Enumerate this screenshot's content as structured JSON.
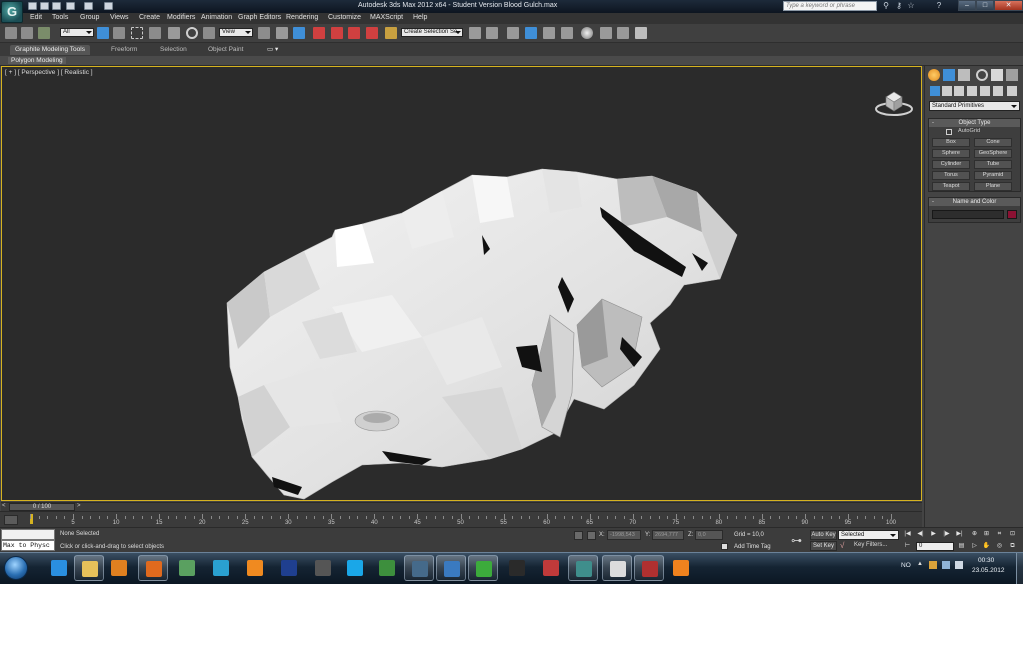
{
  "window": {
    "title": "Autodesk 3ds Max  2012 x64   - Student Version   Blood Gulch.max",
    "logo_letter": "G",
    "help_search_placeholder": "Type a keyword or phrase",
    "min_label": "–",
    "max_label": "□",
    "close_label": "✕"
  },
  "menu": {
    "items": [
      "Edit",
      "Tools",
      "Group",
      "Views",
      "Create",
      "Modifiers",
      "Animation",
      "Graph Editors",
      "Rendering",
      "Customize",
      "MAXScript",
      "Help"
    ]
  },
  "toolbar": {
    "selection_filter": "All",
    "reference_coord": "View",
    "named_selection": "Create Selection Se"
  },
  "ribbon": {
    "tabs": [
      "Graphite Modeling Tools",
      "Freeform",
      "Selection",
      "Object Paint"
    ],
    "active_tab": 0,
    "sub_label": "Polygon Modeling"
  },
  "viewport": {
    "label": "[ + ] [ Perspective ] [ Realistic ]",
    "border_color": "#d6b320",
    "background": "#2b2b2b",
    "axis_x": "#d04040",
    "axis_y": "#40c040",
    "axis_z": "#4080e0"
  },
  "command_panel": {
    "category": "Standard Primitives",
    "object_type_title": "Object Type",
    "autogrid_label": "AutoGrid",
    "buttons": [
      "Box",
      "Cone",
      "Sphere",
      "GeoSphere",
      "Cylinder",
      "Tube",
      "Torus",
      "Pyramid",
      "Teapot",
      "Plane"
    ],
    "name_color_title": "Name and Color",
    "object_color": "#8b1133"
  },
  "timeline": {
    "slider_label": "0 / 100",
    "prev": "<",
    "next": ">",
    "tick_labels": [
      "5",
      "10",
      "15",
      "20",
      "25",
      "30",
      "35",
      "40",
      "45",
      "50",
      "55",
      "60",
      "65",
      "70",
      "75",
      "80",
      "85",
      "90",
      "95",
      "100"
    ]
  },
  "status": {
    "maxscript_input": "Max to Physc",
    "selection_status": "None Selected",
    "prompt": "Click or click-and-drag to select objects",
    "x_label": "X:",
    "x_value": "-1998,543",
    "y_label": "Y:",
    "y_value": "2694,777",
    "z_label": "Z:",
    "z_value": "0,0",
    "grid": "Grid = 10,0",
    "add_time_tag": "Add Time Tag",
    "auto_key": "Auto Key",
    "set_key": "Set Key",
    "keys_filter_value": "Selected",
    "key_filters": "Key Filters...",
    "current_frame": "0"
  },
  "taskbar": {
    "apps": [
      {
        "name": "internet-explorer-icon",
        "color": "#2a8fe0"
      },
      {
        "name": "file-explorer-icon",
        "color": "#e7c15a"
      },
      {
        "name": "media-player-icon",
        "color": "#e08020"
      },
      {
        "name": "firefox-icon",
        "color": "#e06a1e"
      },
      {
        "name": "picture-viewer-icon",
        "color": "#5aa060"
      },
      {
        "name": "cyberlink-icon",
        "color": "#2aa0d0"
      },
      {
        "name": "avast-icon",
        "color": "#f08a20"
      },
      {
        "name": "photoshop-icon",
        "color": "#1f3f8f"
      },
      {
        "name": "udk-icon",
        "color": "#555555"
      },
      {
        "name": "skype-icon",
        "color": "#1aa7e8"
      },
      {
        "name": "gamemaker-icon",
        "color": "#3d8f3d"
      },
      {
        "name": "steam-icon",
        "color": "#456a8a"
      },
      {
        "name": "window-icon",
        "color": "#3a7ac0"
      },
      {
        "name": "utorrent-icon",
        "color": "#3cab3c"
      },
      {
        "name": "valve-icon",
        "color": "#2a2a2a"
      },
      {
        "name": "flag-app-icon",
        "color": "#c03a3a"
      },
      {
        "name": "3dsmax-icon",
        "color": "#3f8e8c"
      },
      {
        "name": "cube-app-icon",
        "color": "#dcdcdc"
      },
      {
        "name": "brush-app-icon",
        "color": "#b03030"
      },
      {
        "name": "blender-icon",
        "color": "#f0821e"
      }
    ],
    "language": "NO",
    "time": "00:30",
    "date": "23.05.2012"
  }
}
